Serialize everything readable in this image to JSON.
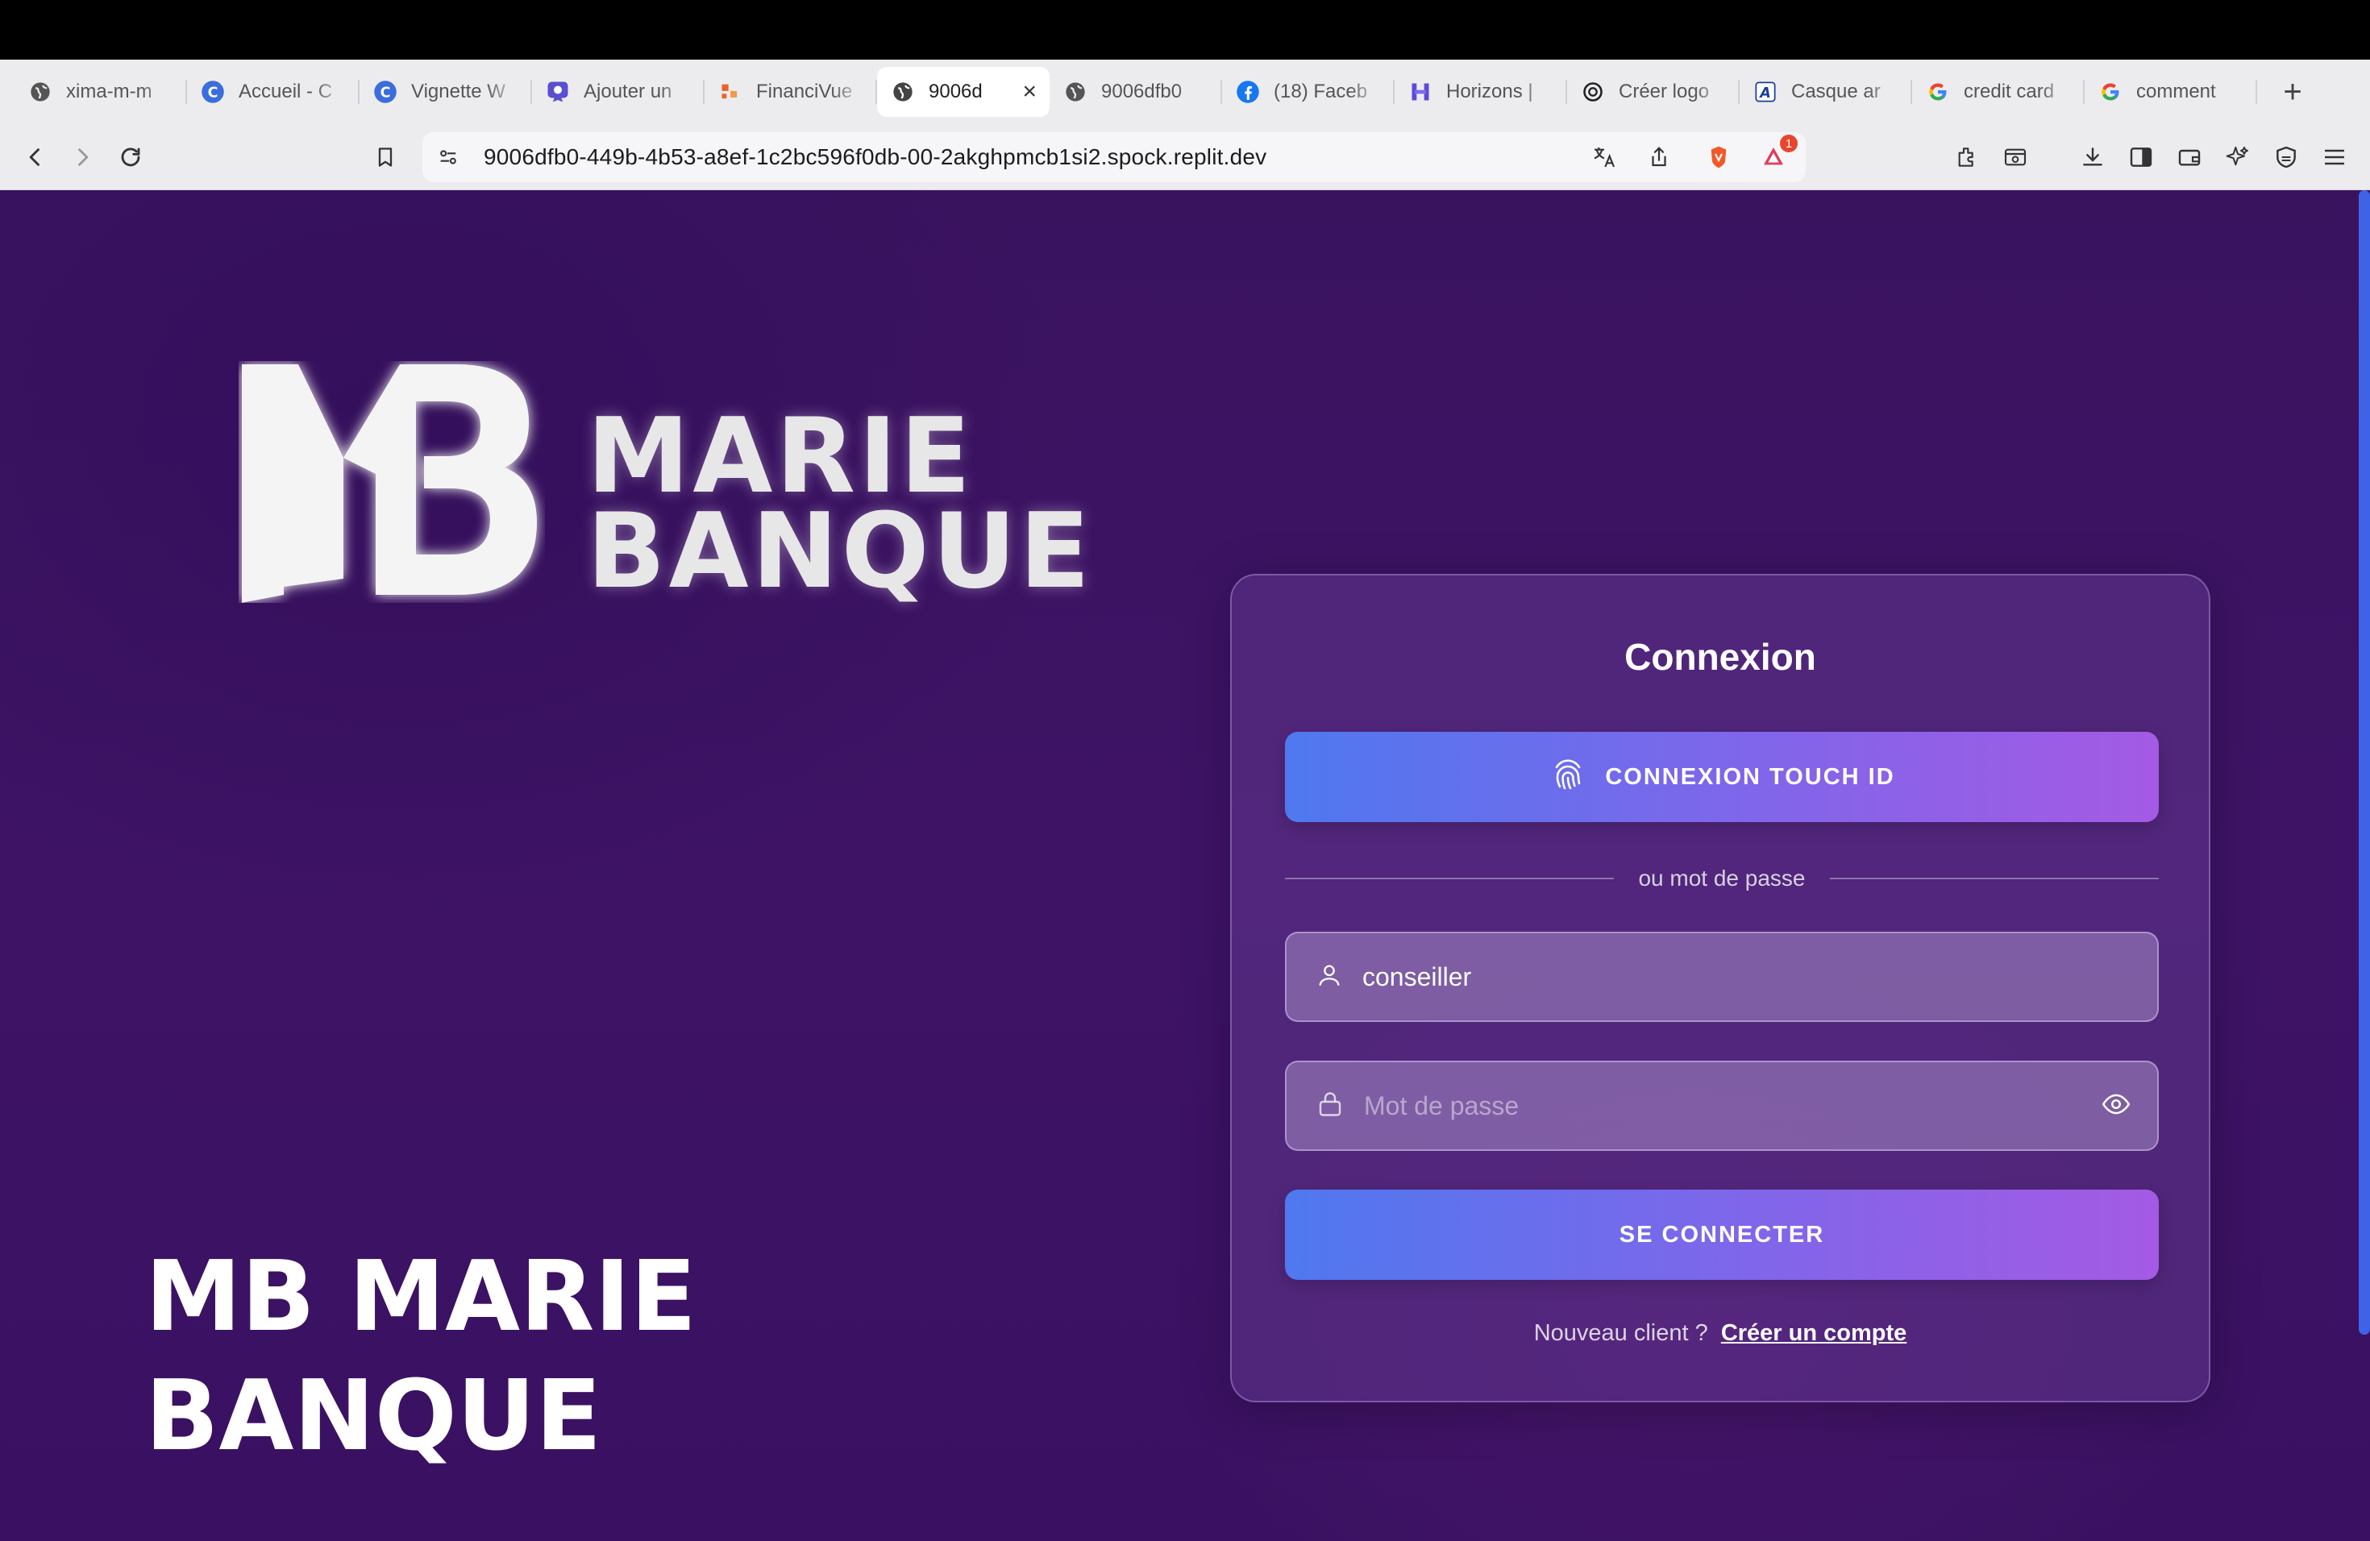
{
  "browser": {
    "tabs": [
      {
        "label": "ximа-m-m",
        "icon": "globe-icon",
        "active": false
      },
      {
        "label": "Accueil - C",
        "icon": "c-logo-icon",
        "active": false
      },
      {
        "label": "Vignette W",
        "icon": "c-logo-icon",
        "active": false
      },
      {
        "label": "Ajouter un",
        "icon": "ribbon-icon",
        "active": false
      },
      {
        "label": "FinanciVue",
        "icon": "financivue-icon",
        "active": false
      },
      {
        "label": "9006d",
        "icon": "globe-icon",
        "active": true
      },
      {
        "label": "9006dfb0",
        "icon": "globe-icon",
        "active": false
      },
      {
        "label": "(18) Faceb",
        "icon": "facebook-icon",
        "active": false
      },
      {
        "label": "Horizons |",
        "icon": "horizons-icon",
        "active": false
      },
      {
        "label": "Créer logo",
        "icon": "openai-icon",
        "active": false
      },
      {
        "label": "Casque ar",
        "icon": "a-logo-icon",
        "active": false
      },
      {
        "label": "credit card",
        "icon": "google-icon",
        "active": false
      },
      {
        "label": "comment",
        "icon": "google-icon",
        "active": false
      }
    ],
    "new_tab": "+",
    "close_tab": "×",
    "url": "9006dfb0-449b-4b53-a8ef-1c2bc596f0db-00-2akghpmcb1si2.spock.replit.dev",
    "alert_badge": "1"
  },
  "brand": {
    "logo_line1": "MARIE",
    "logo_line2": "BANQUE",
    "hero_title": "MB MARIE BANQUE"
  },
  "login": {
    "title": "Connexion",
    "touch_id_label": "CONNEXION TOUCH ID",
    "divider_text": "ou mot de passe",
    "username_value": "conseiller",
    "password_placeholder": "Mot de passe",
    "submit_label": "SE CONNECTER",
    "new_client_text": "Nouveau client ?",
    "create_account_link": "Créer un compte"
  },
  "colors": {
    "page_bg": "#3c1262",
    "button_gradient_start": "#4f78ef",
    "button_gradient_end": "#a45ae4",
    "scrollbar": "#3f63e6"
  }
}
